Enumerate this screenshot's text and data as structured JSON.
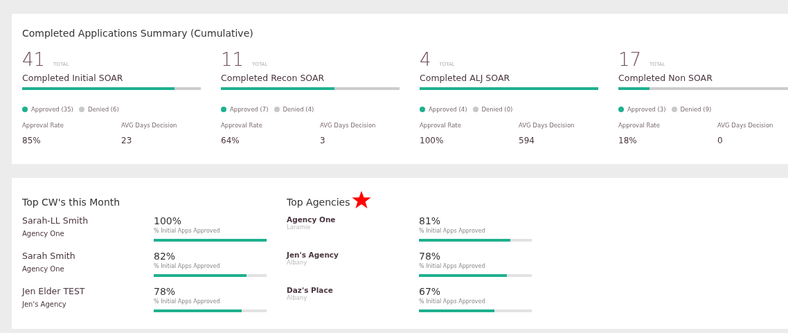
{
  "summary": {
    "title": "Completed Applications Summary (Cumulative)",
    "stats": [
      {
        "total": "41",
        "total_label": "TOTAL",
        "name": "Completed Initial SOAR",
        "level": 0.854,
        "approved": "Approved (35)",
        "denied": "Denied (6)",
        "rate_label": "Approval Rate",
        "rate": "85%",
        "days_label": "AVG Days Decision",
        "days": "23"
      },
      {
        "total": "11",
        "total_label": "TOTAL",
        "name": "Completed Recon SOAR",
        "level": 0.636,
        "approved": "Approved (7)",
        "denied": "Denied (4)",
        "rate_label": "Approval Rate",
        "rate": "64%",
        "days_label": "AVG Days Decision",
        "days": "3"
      },
      {
        "total": "4",
        "total_label": "TOTAL",
        "name": "Completed ALJ SOAR",
        "level": 1,
        "approved": "Approved (4)",
        "denied": "Denied (0)",
        "rate_label": "Approval Rate",
        "rate": "100%",
        "days_label": "AVG Days Decision",
        "days": "594"
      },
      {
        "total": "17",
        "total_label": "TOTAL",
        "name": "Completed Non SOAR",
        "level": 0.176,
        "approved": "Approved (3)",
        "denied": "Denied (9)",
        "rate_label": "Approval Rate",
        "rate": "18%",
        "days_label": "AVG Days Decision",
        "days": "0"
      }
    ]
  },
  "top_cws": {
    "title": "Top CW's this Month",
    "rows": [
      {
        "name": "Sarah-LL Smith",
        "agency": "Agency One",
        "value": "100%",
        "caption": "% Initial Apps Approved",
        "level": 1
      },
      {
        "name": "Sarah Smith",
        "agency": "Agency One",
        "value": "82%",
        "caption": "% Initial Apps Approved",
        "level": 0.82
      },
      {
        "name": "Jen Elder TEST",
        "agency": "Jen's Agency",
        "value": "78%",
        "caption": "% Initial Apps Approved",
        "level": 0.78
      }
    ]
  },
  "top_agencies": {
    "title": "Top Agencies",
    "rows": [
      {
        "name": "Agency One",
        "city": "Laramie",
        "value": "81%",
        "caption": "% Initial Apps Approved",
        "level": 0.81
      },
      {
        "name": "Jen's Agency",
        "city": "Albany",
        "value": "78%",
        "caption": "% Initial Apps Approved",
        "level": 0.78
      },
      {
        "name": "Daz's Place",
        "city": "Albany",
        "value": "67%",
        "caption": "% Initial Apps Approved",
        "level": 0.67
      }
    ]
  }
}
